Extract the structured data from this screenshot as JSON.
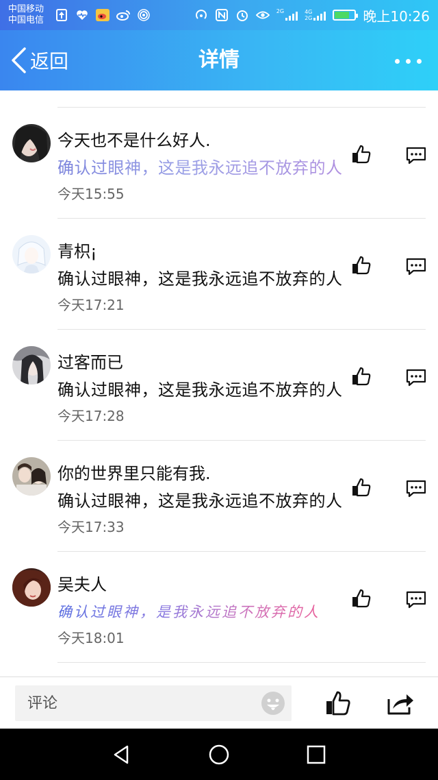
{
  "status_bar": {
    "carrier_1": "中国移动",
    "carrier_2": "中国电信",
    "network_1": "2G",
    "network_2": "4G",
    "network_3": "2G",
    "time": "晚上10:26",
    "icons": [
      "upload-icon",
      "heart-rate-icon",
      "weibo-icon",
      "weibo-icon-2",
      "hotspot-icon",
      "nfc-icon",
      "alarm-icon",
      "eye-icon",
      "signal-icon",
      "battery-icon"
    ]
  },
  "nav": {
    "back_label": "返回",
    "title": "详情",
    "more_icon": "more-icon"
  },
  "comments": [
    {
      "username": "今天也不是什么好人.",
      "text": "确认过眼神，这是我永远追不放弃的人",
      "time": "今天15:55",
      "style": "grad1"
    },
    {
      "username": "青枳¡",
      "text": "确认过眼神，这是我永远追不放弃的人",
      "time": "今天17:21",
      "style": "plain"
    },
    {
      "username": "过客而已",
      "text": "确认过眼神，这是我永远追不放弃的人",
      "time": "今天17:28",
      "style": "plain"
    },
    {
      "username": "你的世界里只能有我.",
      "text": "确认过眼神，这是我永远追不放弃的人",
      "time": "今天17:33",
      "style": "plain"
    },
    {
      "username": "吴夫人",
      "text": "确认过眼神，是我永远追不放弃的人",
      "time": "今天18:01",
      "style": "grad2"
    }
  ],
  "bottom_bar": {
    "input_placeholder": "评论",
    "icons": [
      "emoji-icon",
      "thumbs-up-icon",
      "share-icon"
    ]
  },
  "system_nav": {
    "icons": [
      "back-triangle-icon",
      "home-circle-icon",
      "recents-square-icon"
    ]
  },
  "colors": {
    "header_start": "#3a86ef",
    "header_end": "#2ed0f8",
    "divider": "#e3e3e3",
    "time_text": "#666666"
  }
}
